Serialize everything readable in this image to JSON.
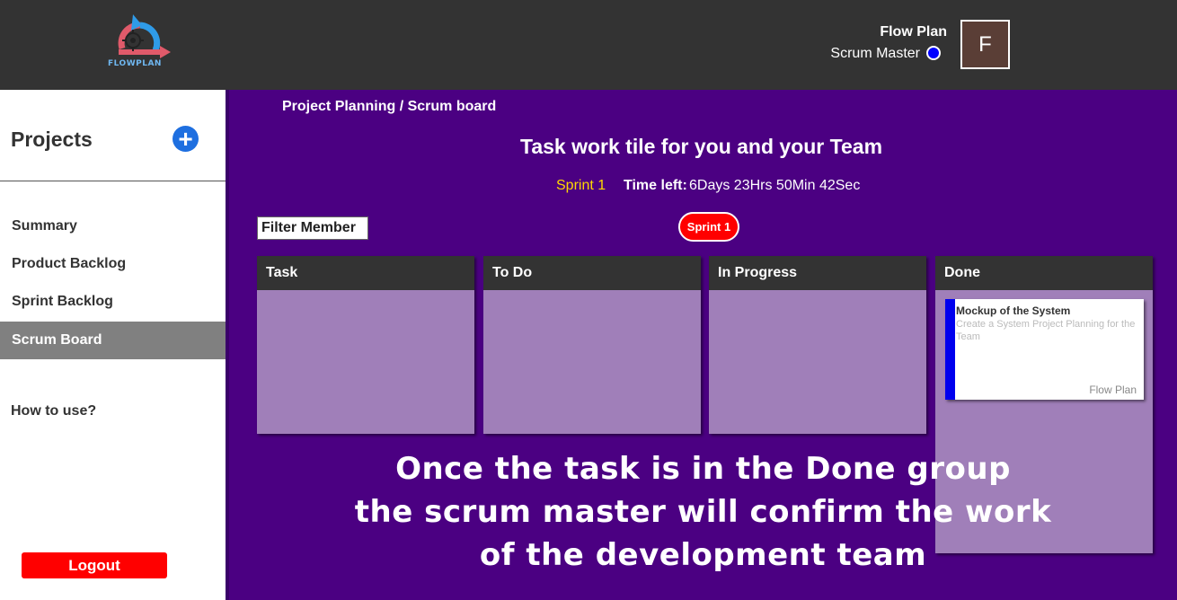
{
  "header": {
    "logo_text": "FLOWPLAN",
    "user_name": "Flow Plan",
    "user_role": "Scrum Master",
    "avatar_initial": "F"
  },
  "sidebar": {
    "title": "Projects",
    "add_label": "+",
    "items": [
      {
        "label": "Summary",
        "active": false
      },
      {
        "label": "Product Backlog",
        "active": false
      },
      {
        "label": "Sprint Backlog",
        "active": false
      },
      {
        "label": "Scrum Board",
        "active": true
      }
    ],
    "help_label": "How to use?",
    "logout_label": "Logout"
  },
  "main": {
    "breadcrumb": "Project Planning / Scrum board",
    "title": "Task work tile for you and your Team",
    "sprint_label": "Sprint 1",
    "time_left_label": "Time left:",
    "time_left_value": "6Days 23Hrs 50Min 42Sec",
    "filter_member_label": "Filter Member",
    "sprint_badge": "Sprint 1"
  },
  "board": {
    "columns": [
      {
        "title": "Task",
        "cards": []
      },
      {
        "title": "To Do",
        "cards": []
      },
      {
        "title": "In Progress",
        "cards": []
      },
      {
        "title": "Done",
        "cards": [
          {
            "title": "Mockup of the System",
            "description": "Create a System Project Planning for the Team",
            "owner": "Flow Plan"
          }
        ]
      }
    ]
  },
  "overlay": {
    "lines": [
      "Once the task is in the Done group",
      "the scrum master will confirm the work",
      "of the development team"
    ]
  },
  "colors": {
    "header_bg": "#333333",
    "main_bg": "#4b0082",
    "column_body": "#a07fb9",
    "accent_blue": "#1e6fe0",
    "danger_red": "#ff0000",
    "sprint_yellow": "#ffd700",
    "card_bar_blue": "#0000ee"
  }
}
